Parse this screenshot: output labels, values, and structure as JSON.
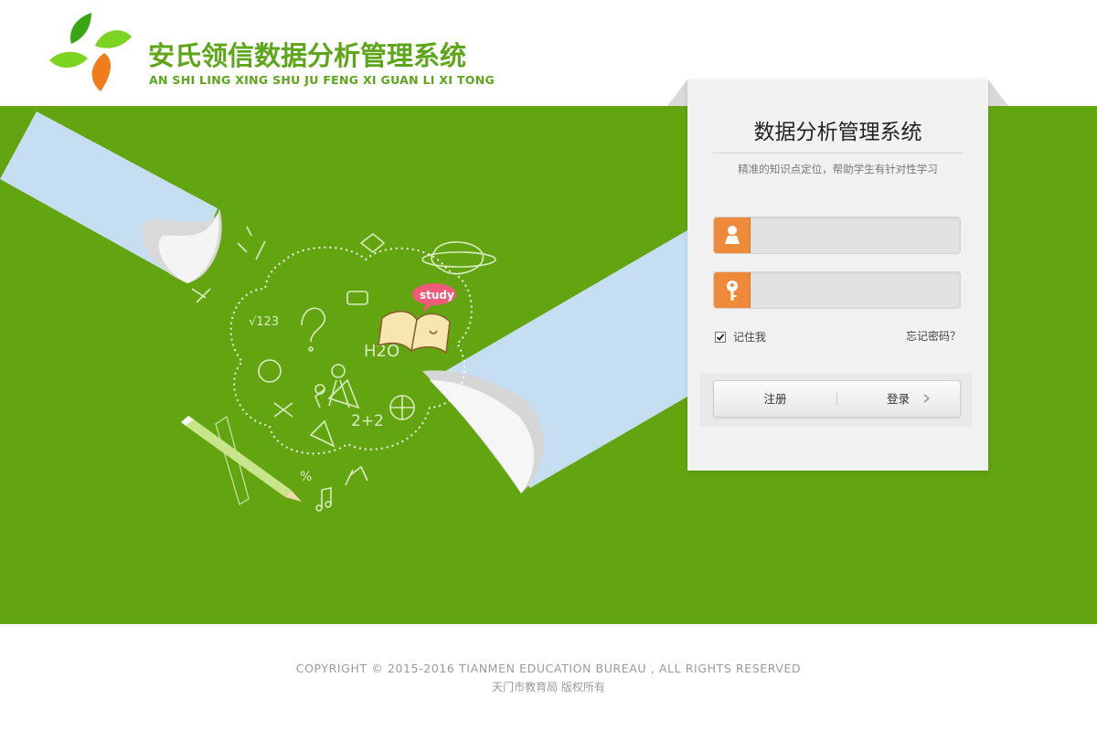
{
  "brand": {
    "title": "安氏领信数据分析管理系统",
    "pinyin": "AN SHI LING XING SHU JU FENG XI GUAN LI XI TONG"
  },
  "banner": {
    "badge_text": "study",
    "doodles": [
      "√123",
      "H2O",
      "2+2",
      "%"
    ]
  },
  "login": {
    "title": "数据分析管理系统",
    "subtitle": "精准的知识点定位，帮助学生有针对性学习",
    "username": {
      "value": "",
      "icon": "user-icon"
    },
    "password": {
      "value": "",
      "icon": "key-icon"
    },
    "remember_label": "记住我",
    "remember_checked": true,
    "forgot_label": "忘记密码？",
    "register_label": "注册",
    "login_label": "登录"
  },
  "footer": {
    "copyright": "COPYRIGHT © 2015-2016 TIANMEN EDUCATION BUREAU , ALL RIGHTS RESERVED",
    "owner": "天门市教育局 版权所有"
  },
  "colors": {
    "brand_green": "#5da61a",
    "banner_green": "#63a510",
    "accent_orange": "#ef8a3a"
  }
}
